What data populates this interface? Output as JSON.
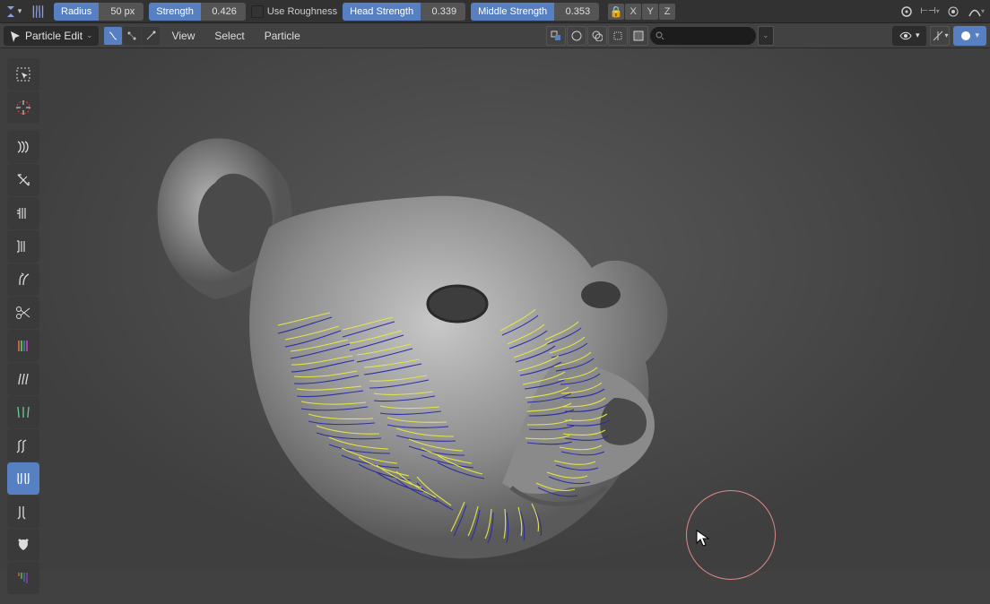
{
  "top": {
    "radius": {
      "label": "Radius",
      "value": "50 px"
    },
    "strength": {
      "label": "Strength",
      "value": "0.426"
    },
    "roughness_label": "Use Roughness",
    "head": {
      "label": "Head Strength",
      "value": "0.339"
    },
    "middle": {
      "label": "Middle Strength",
      "value": "0.353"
    },
    "axes": [
      "X",
      "Y",
      "Z"
    ]
  },
  "mode": {
    "label": "Particle Edit"
  },
  "menus": {
    "view": "View",
    "select": "Select",
    "particle": "Particle"
  },
  "tools": [
    "select-box",
    "cursor",
    "comb",
    "smooth",
    "add",
    "length",
    "puff",
    "cut",
    "weight",
    "grow",
    "shrink",
    "curl",
    "random",
    "draw"
  ]
}
